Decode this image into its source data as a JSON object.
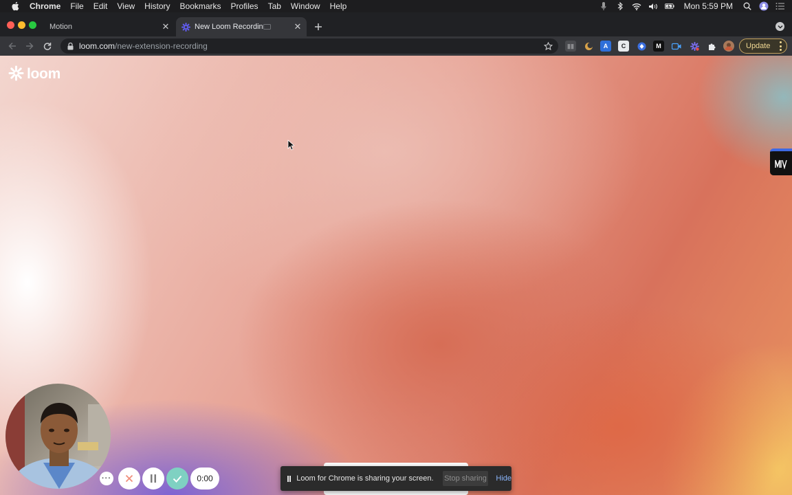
{
  "menubar": {
    "app_name": "Chrome",
    "items": [
      "File",
      "Edit",
      "View",
      "History",
      "Bookmarks",
      "Profiles",
      "Tab",
      "Window",
      "Help"
    ],
    "clock": "Mon 5:59 PM",
    "status_icons": [
      "microphone-icon",
      "bluetooth-icon",
      "wifi-icon",
      "volume-icon",
      "battery-icon",
      "search-icon",
      "user-icon",
      "control-center-icon"
    ]
  },
  "tabs": [
    {
      "label": "Motion",
      "active": false
    },
    {
      "label": "New Loom Recording",
      "active": true,
      "favicon": "loom-icon"
    }
  ],
  "toolbar": {
    "url_host": "loom.com",
    "url_path": "/new-extension-recording",
    "update_label": "Update"
  },
  "page": {
    "logo_text": "loom"
  },
  "recorder": {
    "more_label": "···",
    "timer": "0:00"
  },
  "sharing_bar": {
    "message": "Loom for Chrome is sharing your screen.",
    "stop_label": "Stop sharing",
    "hide_label": "Hide"
  },
  "colors": {
    "accent_blue": "#8ab4f8",
    "update_gold": "#f1d893",
    "done_green": "#7fd1c2",
    "loom_purple": "#625df5"
  }
}
